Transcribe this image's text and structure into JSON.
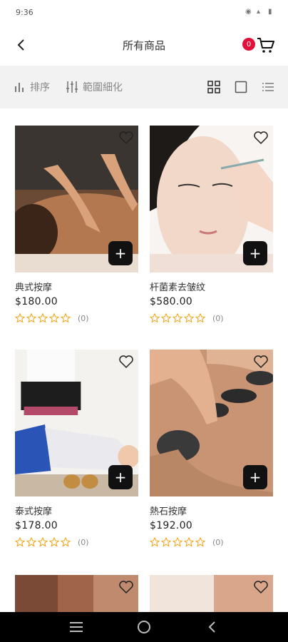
{
  "status": {
    "time": "9:36"
  },
  "header": {
    "title": "所有商品",
    "cart_count": "0"
  },
  "toolbar": {
    "sort_label": "排序",
    "filter_label": "範圍細化"
  },
  "products": [
    {
      "name": "典式按摩",
      "price": "$180.00",
      "reviews": "(0)"
    },
    {
      "name": "杆菌素去皱纹",
      "price": "$580.00",
      "reviews": "(0)"
    },
    {
      "name": "泰式按摩",
      "price": "$178.00",
      "reviews": "(0)"
    },
    {
      "name": "熱石按摩",
      "price": "$192.00",
      "reviews": "(0)"
    }
  ],
  "colors": {
    "accent": "#e0103a",
    "star": "#f5a623",
    "toolbar_bg": "#f2f2f2"
  }
}
